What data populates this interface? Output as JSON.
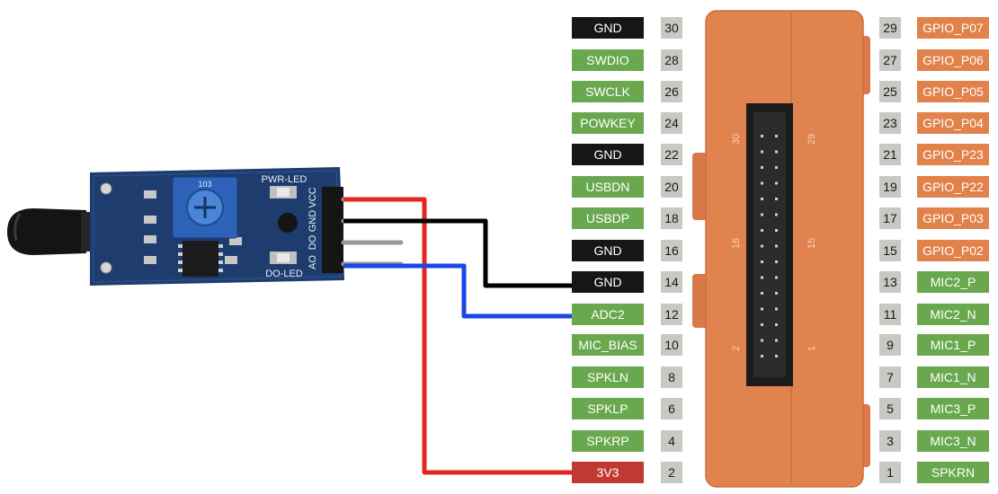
{
  "colors": {
    "gnd": "#161616",
    "green": "#6aa84f",
    "orange": "#e1824b",
    "power": "#c03a33",
    "pin_number_bg": "#c9c9c3",
    "wire_vcc": "#e52620",
    "wire_gnd": "#000000",
    "wire_signal": "#1a47e6",
    "board_body": "#e0834e",
    "sensor_pcb": "#1e3d6e"
  },
  "sensor": {
    "pwr_led_label": "PWR-LED",
    "do_led_label": "DO-LED",
    "pin_labels": [
      "VCC",
      "GND",
      "DO",
      "AO"
    ],
    "pot_text": "103"
  },
  "connector": {
    "labels": [
      "30",
      "29",
      "16",
      "15",
      "2",
      "1"
    ]
  },
  "pins_left": [
    {
      "label": "GND",
      "number": "30",
      "color": "gnd"
    },
    {
      "label": "SWDIO",
      "number": "28",
      "color": "green"
    },
    {
      "label": "SWCLK",
      "number": "26",
      "color": "green"
    },
    {
      "label": "POWKEY",
      "number": "24",
      "color": "green"
    },
    {
      "label": "GND",
      "number": "22",
      "color": "gnd"
    },
    {
      "label": "USBDN",
      "number": "20",
      "color": "green"
    },
    {
      "label": "USBDP",
      "number": "18",
      "color": "green"
    },
    {
      "label": "GND",
      "number": "16",
      "color": "gnd"
    },
    {
      "label": "GND",
      "number": "14",
      "color": "gnd"
    },
    {
      "label": "ADC2",
      "number": "12",
      "color": "green"
    },
    {
      "label": "MIC_BIAS",
      "number": "10",
      "color": "green"
    },
    {
      "label": "SPKLN",
      "number": "8",
      "color": "green"
    },
    {
      "label": "SPKLP",
      "number": "6",
      "color": "green"
    },
    {
      "label": "SPKRP",
      "number": "4",
      "color": "green"
    },
    {
      "label": "3V3",
      "number": "2",
      "color": "power"
    }
  ],
  "pins_right": [
    {
      "label": "GPIO_P07",
      "number": "29",
      "color": "orange"
    },
    {
      "label": "GPIO_P06",
      "number": "27",
      "color": "orange"
    },
    {
      "label": "GPIO_P05",
      "number": "25",
      "color": "orange"
    },
    {
      "label": "GPIO_P04",
      "number": "23",
      "color": "orange"
    },
    {
      "label": "GPIO_P23",
      "number": "21",
      "color": "orange"
    },
    {
      "label": "GPIO_P22",
      "number": "19",
      "color": "orange"
    },
    {
      "label": "GPIO_P03",
      "number": "17",
      "color": "orange"
    },
    {
      "label": "GPIO_P02",
      "number": "15",
      "color": "orange"
    },
    {
      "label": "MIC2_P",
      "number": "13",
      "color": "green"
    },
    {
      "label": "MIC2_N",
      "number": "11",
      "color": "green"
    },
    {
      "label": "MIC1_P",
      "number": "9",
      "color": "green"
    },
    {
      "label": "MIC1_N",
      "number": "7",
      "color": "green"
    },
    {
      "label": "MIC3_P",
      "number": "5",
      "color": "green"
    },
    {
      "label": "MIC3_N",
      "number": "3",
      "color": "green"
    },
    {
      "label": "SPKRN",
      "number": "1",
      "color": "green"
    }
  ]
}
